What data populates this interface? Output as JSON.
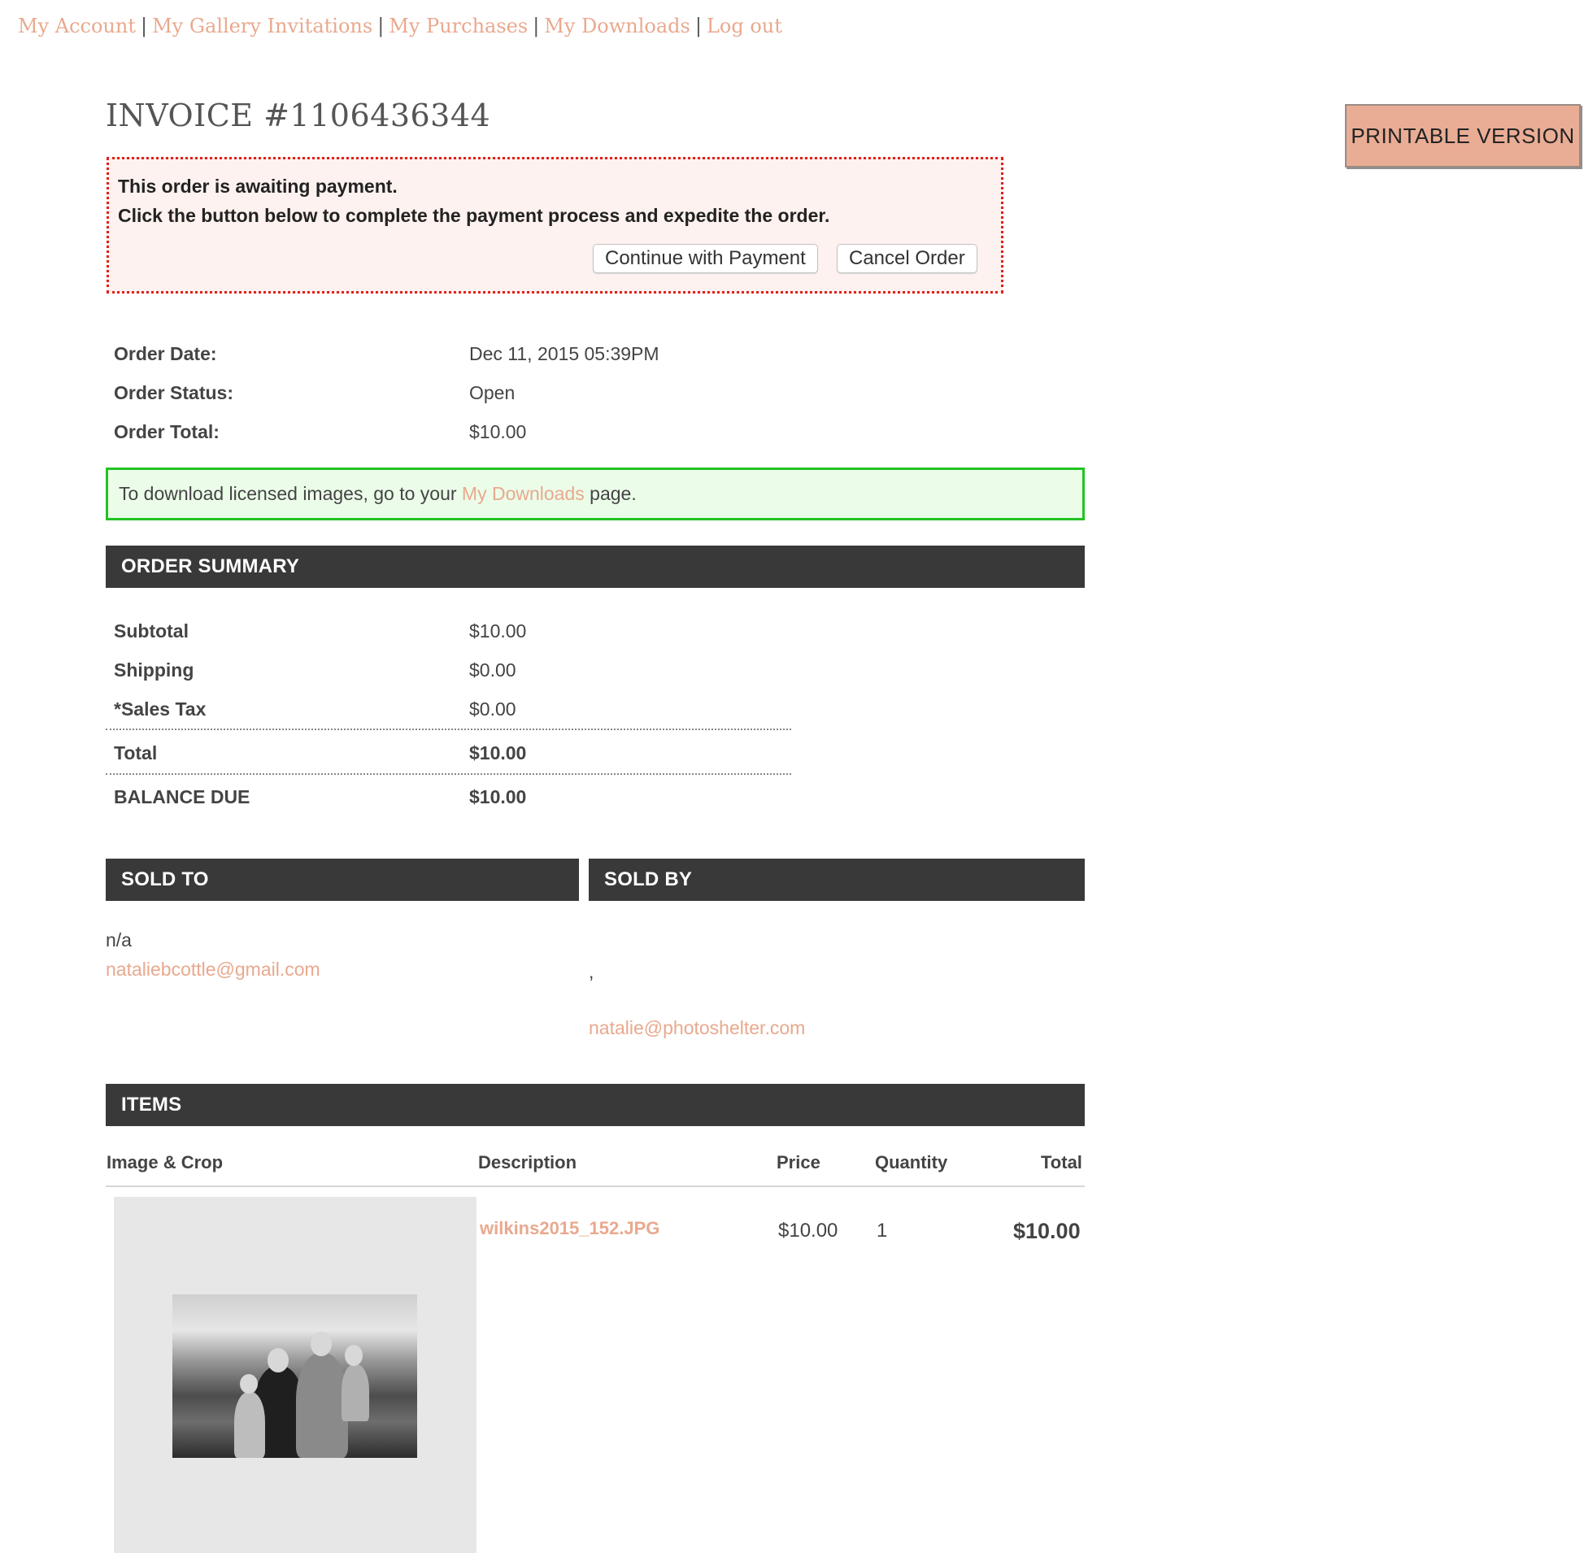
{
  "nav": {
    "items": [
      "My Account",
      "My Gallery Invitations",
      "My Purchases",
      "My Downloads",
      "Log out"
    ],
    "separator": "|"
  },
  "invoice": {
    "title": "INVOICE #1106436344",
    "printable_label": "PRINTABLE VERSION"
  },
  "payment_notice": {
    "line1": "This order is awaiting payment.",
    "line2": "Click the button below to complete the payment process and expedite the order.",
    "continue_label": "Continue with Payment",
    "cancel_label": "Cancel Order"
  },
  "order_info": {
    "date_label": "Order Date:",
    "date_value": "Dec 11, 2015 05:39PM",
    "status_label": "Order Status:",
    "status_value": "Open",
    "total_label": "Order Total:",
    "total_value": "$10.00"
  },
  "download_note": {
    "prefix": "To download licensed images, go to your ",
    "link": "My Downloads",
    "suffix": " page."
  },
  "order_summary": {
    "heading": "ORDER SUMMARY",
    "subtotal_label": "Subtotal",
    "subtotal_value": "$10.00",
    "shipping_label": "Shipping",
    "shipping_value": "$0.00",
    "tax_label": "*Sales Tax",
    "tax_value": "$0.00",
    "total_label": "Total",
    "total_value": "$10.00",
    "balance_label": "BALANCE DUE",
    "balance_value": "$10.00"
  },
  "sold_to": {
    "heading": "SOLD TO",
    "name": "n/a",
    "email": "nataliebcottle@gmail.com"
  },
  "sold_by": {
    "heading": "SOLD BY",
    "address": ",",
    "email": "natalie@photoshelter.com"
  },
  "items": {
    "heading": "ITEMS",
    "columns": [
      "Image & Crop",
      "Description",
      "Price",
      "Quantity",
      "Total"
    ],
    "rows": [
      {
        "description": "wilkins2015_152.JPG",
        "price": "$10.00",
        "quantity": "1",
        "total": "$10.00"
      }
    ]
  },
  "colors": {
    "link": "#e9a98e",
    "section_bar": "#393939",
    "alert_border": "#e0201a",
    "success_border": "#22c322",
    "printable_button": "#e9ad95"
  }
}
